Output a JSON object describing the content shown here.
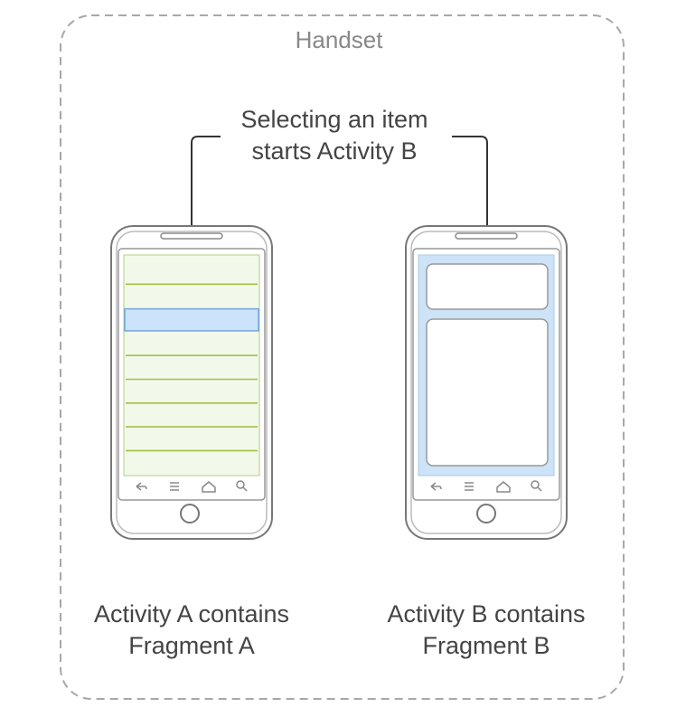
{
  "container": {
    "title": "Handset"
  },
  "annotation": {
    "line1": "Selecting an item",
    "line2": "starts Activity B"
  },
  "phone_a": {
    "caption_line1": "Activity A contains",
    "caption_line2": "Fragment A",
    "list_rows": 9,
    "selected_row": 2
  },
  "phone_b": {
    "caption_line1": "Activity B contains",
    "caption_line2": "Fragment B"
  },
  "colors": {
    "list_background": "#f3f9ea",
    "list_divider": "#9fc244",
    "selected_fill": "#cce4fb",
    "selected_stroke": "#6fa7df",
    "fragment_background": "#cde3f7",
    "phone_stroke": "#777777",
    "dashed_border": "#a8a8a8",
    "text": "#444444",
    "title_text": "#888888"
  },
  "icons": [
    "back-icon",
    "menu-icon",
    "home-icon",
    "search-icon"
  ]
}
